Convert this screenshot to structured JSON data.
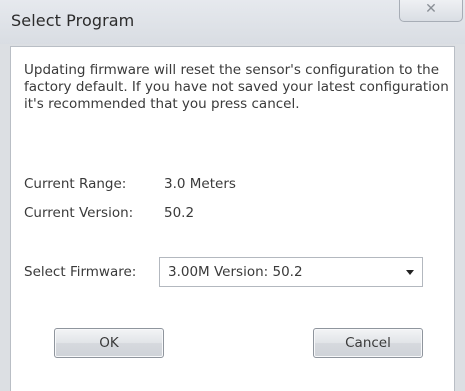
{
  "dialog": {
    "title": "Select Program",
    "close_glyph": "✕"
  },
  "message": "Updating firmware will reset the sensor's configuration to the factory default. If you have not saved your latest configuration it's recommended that you press cancel.",
  "info": {
    "range_label": "Current Range:",
    "range_value": "3.0 Meters",
    "version_label": "Current Version:",
    "version_value": "50.2"
  },
  "firmware": {
    "label": "Select Firmware:",
    "selected": "3.00M  Version: 50.2"
  },
  "buttons": {
    "ok": "OK",
    "cancel": "Cancel"
  }
}
